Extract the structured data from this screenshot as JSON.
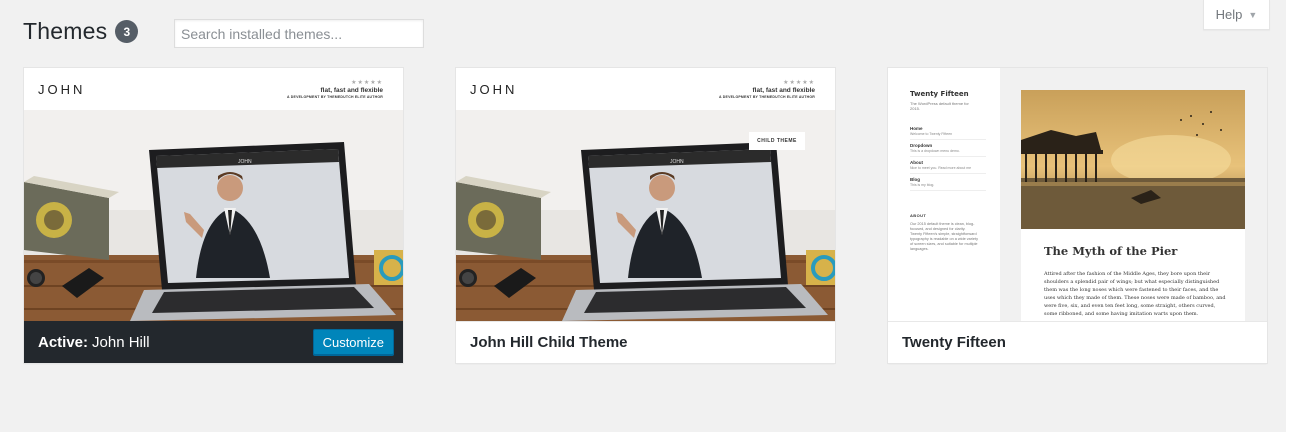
{
  "header": {
    "title": "Themes",
    "count": "3",
    "search_placeholder": "Search installed themes..."
  },
  "help": {
    "label": "Help",
    "chevron": "▼"
  },
  "themes": [
    {
      "active_label": "Active:",
      "name": "John Hill",
      "customize_label": "Customize",
      "preview": {
        "logo": "JOHN",
        "stars": "★★★★★",
        "tagline": "flat, fast and flexible",
        "subtag": "A DEVELOPMENT BY THEMEDUTCH ELITE AUTHOR",
        "screen_logo": "JOHN"
      }
    },
    {
      "name": "John Hill Child Theme",
      "preview": {
        "logo": "JOHN",
        "stars": "★★★★★",
        "tagline": "flat, fast and flexible",
        "subtag": "A DEVELOPMENT BY THEMEDUTCH ELITE AUTHOR",
        "badge": "CHILD THEME",
        "screen_logo": "JOHN"
      }
    },
    {
      "name": "Twenty Fifteen",
      "preview": {
        "site_title": "Twenty Fifteen",
        "site_desc": "The WordPress default theme for 2015.",
        "menu": [
          {
            "title": "Home",
            "sub": "Welcome to Twenty Fifteen"
          },
          {
            "title": "Dropdown",
            "sub": "This is a dropdown menu demo."
          },
          {
            "title": "About",
            "sub": "Nice to meet you. Read more about me"
          },
          {
            "title": "Blog",
            "sub": "This is my blog."
          }
        ],
        "about_heading": "ABOUT",
        "about_text": "Our 2015 default theme is clean, blog-focused, and designed for clarity. Twenty Fifteen's simple, straightforward typography is readable on a wide variety of screen sizes, and suitable for multiple languages.",
        "article_title": "The Myth of the Pier",
        "article_body": "Attired after the fashion of the Middle Ages, they bore upon their shoulders a splendid pair of wings; but what especially distinguished them was the long noses which were fastened to their faces, and the uses which they made of them. These noses were made of bamboo, and were five, six, and even ten feet long, some straight, others curved, some ribboned, and some having imitation warts upon them."
      }
    }
  ],
  "colors": {
    "background": "#f1f1f1",
    "active_bar": "#23282d",
    "button_blue": "#0085ba",
    "badge": "#555d66"
  }
}
